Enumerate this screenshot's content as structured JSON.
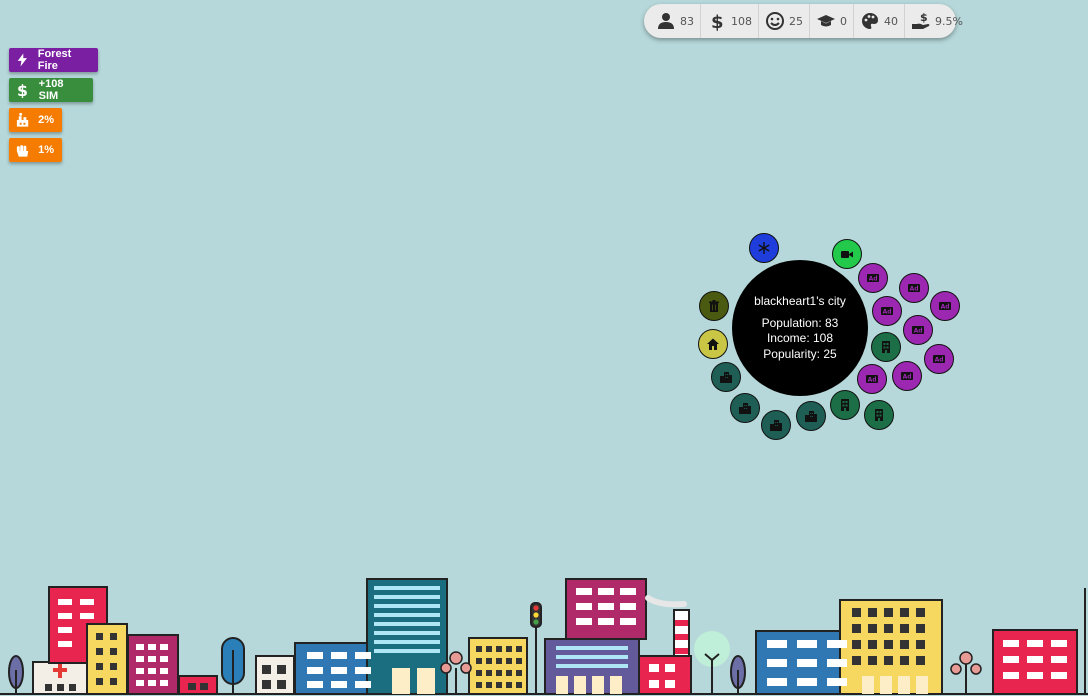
{
  "stats": {
    "population": "83",
    "money": "108",
    "happiness": "25",
    "education": "0",
    "culture": "40",
    "tax": "9.5%"
  },
  "actions": {
    "event_label": "Forest Fire",
    "income_label": "+108 SIM",
    "pollution_label": "2%",
    "unrest_label": "1%"
  },
  "city": {
    "name": "blackheart1's city",
    "population": "Population: 83",
    "income": "Income: 108",
    "popularity": "Popularity: 25"
  },
  "colors": {
    "background": "#b6d8da",
    "event": "#7b1fa2",
    "income": "#388e3c",
    "warning": "#f57c00",
    "ad": "#9c27b0",
    "office": "#1b6e45",
    "residential": "#1e5e55",
    "snow": "#1e3ddb",
    "video": "#22c94a",
    "trash": "#4a5a10",
    "home": "#c9c646"
  }
}
